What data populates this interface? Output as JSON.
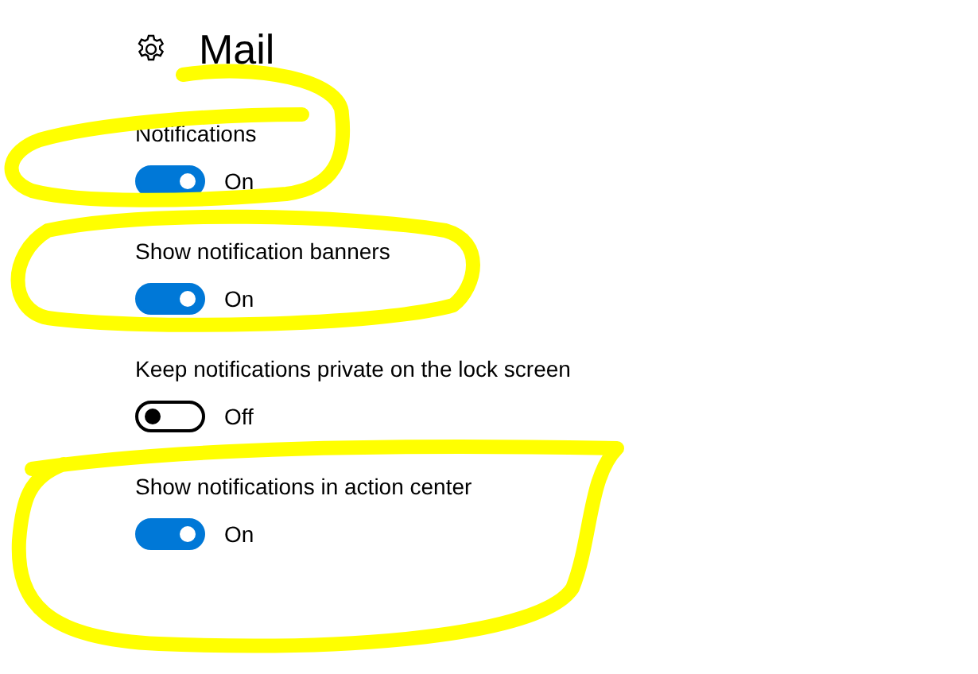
{
  "header": {
    "title": "Mail"
  },
  "settings": [
    {
      "label": "Notifications",
      "on": true,
      "state_text": "On"
    },
    {
      "label": "Show notification banners",
      "on": true,
      "state_text": "On"
    },
    {
      "label": "Keep notifications private on the lock screen",
      "on": false,
      "state_text": "Off"
    },
    {
      "label": "Show notifications in action center",
      "on": true,
      "state_text": "On"
    }
  ]
}
